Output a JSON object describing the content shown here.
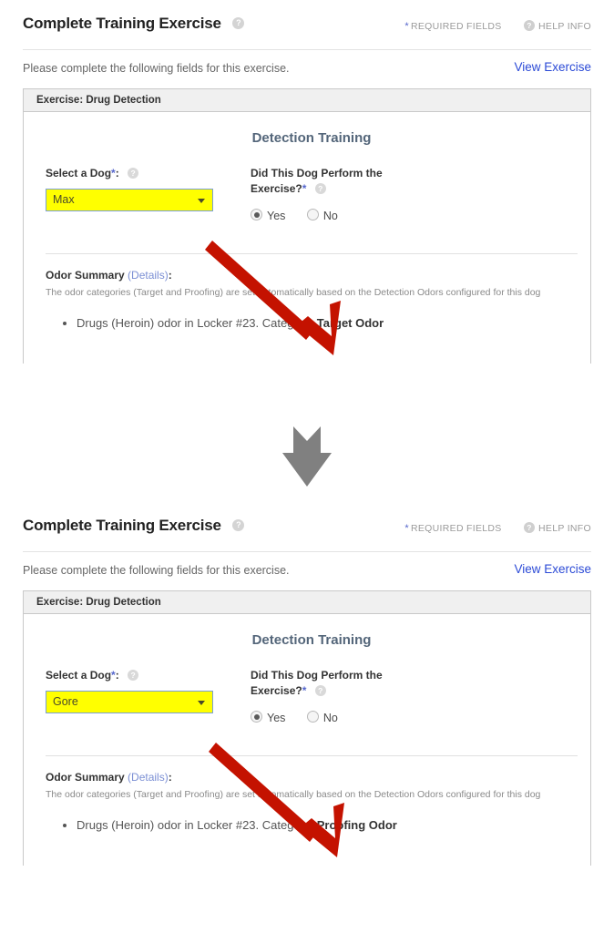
{
  "panels": [
    {
      "title": "Complete Training Exercise",
      "title_help_icon": "help-circle-icon",
      "required_fields_label": "REQUIRED FIELDS",
      "required_star": "*",
      "help_info_label": "HELP INFO",
      "help_info_icon": "help-circle-icon",
      "lead_text": "Please complete the following fields for this exercise.",
      "view_exercise_label": "View Exercise",
      "exercise_header": "Exercise: Drug Detection",
      "section_title": "Detection Training",
      "dog_label": "Select a Dog",
      "dog_label_star": "*",
      "dog_label_colon": ":",
      "dog_value": "Max",
      "dog_caret_icon": "chevron-down-icon",
      "perform_label_line1": "Did This Dog Perform the",
      "perform_label_line2": "Exercise?",
      "perform_label_star": "*",
      "radio_yes": "Yes",
      "radio_no": "No",
      "radio_selected": "Yes",
      "odor_summary_label": "Odor Summary",
      "odor_details_label": "(Details)",
      "odor_colon": ":",
      "odor_note": "The odor categories (Target and Proofing) are set automatically based on the Detection Odors configured for this dog",
      "odor_item_text": "Drugs (Heroin) odor in Locker #23. Category: ",
      "odor_item_category": "Target Odor"
    },
    {
      "title": "Complete Training Exercise",
      "title_help_icon": "help-circle-icon",
      "required_fields_label": "REQUIRED FIELDS",
      "required_star": "*",
      "help_info_label": "HELP INFO",
      "help_info_icon": "help-circle-icon",
      "lead_text": "Please complete the following fields for this exercise.",
      "view_exercise_label": "View Exercise",
      "exercise_header": "Exercise: Drug Detection",
      "section_title": "Detection Training",
      "dog_label": "Select a Dog",
      "dog_label_star": "*",
      "dog_label_colon": ":",
      "dog_value": "Gore",
      "dog_caret_icon": "chevron-down-icon",
      "perform_label_line1": "Did This Dog Perform the",
      "perform_label_line2": "Exercise?",
      "perform_label_star": "*",
      "radio_yes": "Yes",
      "radio_no": "No",
      "radio_selected": "Yes",
      "odor_summary_label": "Odor Summary",
      "odor_details_label": "(Details)",
      "odor_colon": ":",
      "odor_note": "The odor categories (Target and Proofing) are set automatically based on the Detection Odors configured for this dog",
      "odor_item_text": "Drugs (Heroin) odor in Locker #23. Category: ",
      "odor_item_category": "Proofing Odor"
    }
  ],
  "annotations": {
    "transition_arrow_icon": "down-arrow-icon",
    "callout_arrow_icon": "red-pointer-arrow-icon"
  },
  "colors": {
    "highlight": "#ffff00",
    "link": "#2b4ad6",
    "callout_red": "#c41200",
    "transition_gray": "#808080",
    "section_title": "#54667a",
    "required_star": "#5566cc"
  }
}
